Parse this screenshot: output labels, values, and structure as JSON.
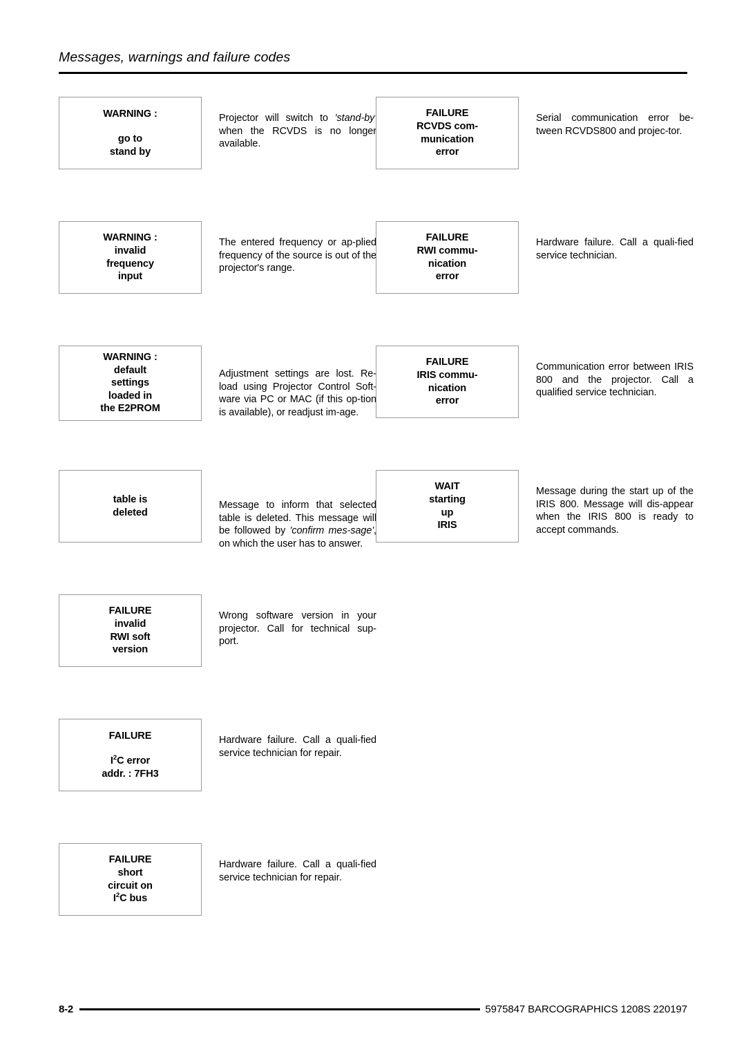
{
  "header": {
    "title": "Messages, warnings and failure codes"
  },
  "footer": {
    "page_number": "8-2",
    "reference": "5975847 BARCOGRAPHICS 1208S 220197"
  },
  "columns": {
    "left": [
      {
        "box_lines": [
          "WARNING :",
          "go to",
          "stand by"
        ],
        "gap_after_first": true,
        "description_html": "Projector will switch to <i>'stand-by'</i> when the RCVDS  is no longer available.",
        "description_text": "Projector will switch to 'stand-by' when the RCVDS is no longer available."
      },
      {
        "box_lines": [
          "WARNING :",
          "invalid",
          "frequency",
          "input"
        ],
        "gap_after_first": false,
        "description_html": "The entered frequency or ap-plied frequency of the source is out of the projector's range.",
        "description_text": "The entered frequency or applied frequency of the source is out of the projector's range."
      },
      {
        "box_lines": [
          "WARNING :",
          "default",
          "settings",
          "loaded in",
          "the E2PROM"
        ],
        "gap_after_first": false,
        "description_html": "Adjustment settings are lost. Re-load using Projector Control Soft-ware via PC or MAC (if this op-tion is available), or readjust im-age.",
        "description_text": "Adjustment settings are lost. Reload using Projector Control Software via PC or MAC (if this option is available), or readjust image."
      },
      {
        "box_lines": [
          "table is",
          "deleted"
        ],
        "gap_after_first": false,
        "description_html": "Message to inform that selected table is deleted.  This message will be followed by <i>'confirm mes-sage'</i>, on which the user has to answer.",
        "description_text": "Message to inform that selected table is deleted. This message will be followed by 'confirm message', on which the user has to answer."
      },
      {
        "box_lines": [
          "FAILURE",
          "invalid",
          "RWI soft",
          "version"
        ],
        "gap_after_first": false,
        "description_html": "Wrong software version in your projector.  Call for technical sup-port.",
        "description_text": "Wrong software version in your projector. Call for technical support."
      },
      {
        "box_lines": [
          "FAILURE",
          "I2C error",
          "addr. : 7FH3"
        ],
        "gap_after_first": true,
        "description_html": "Hardware failure.  Call a quali-fied service technician for repair.",
        "description_text": "Hardware failure. Call a qualified service technician for repair."
      },
      {
        "box_lines": [
          "FAILURE",
          "short",
          "circuit on",
          "I2C bus"
        ],
        "gap_after_first": false,
        "description_html": "Hardware failure.  Call a quali-fied service technician for repair.",
        "description_text": "Hardware failure. Call a qualified service technician for repair."
      }
    ],
    "right": [
      {
        "box_lines": [
          "FAILURE",
          "RCVDS com-",
          "munication",
          "error"
        ],
        "gap_after_first": false,
        "description_html": "Serial communication error be-tween RCVDS800 and projec-tor.",
        "description_text": "Serial communication error between RCVDS800 and projector."
      },
      {
        "box_lines": [
          "FAILURE",
          "RWI commu-",
          "nication",
          "error"
        ],
        "gap_after_first": false,
        "description_html": "Hardware failure.  Call a quali-fied service technician.",
        "description_text": "Hardware failure. Call a qualified service technician."
      },
      {
        "box_lines": [
          "FAILURE",
          "IRIS commu-",
          "nication",
          "error"
        ],
        "gap_after_first": false,
        "description_html": "Communication error between IRIS 800 and the projector. Call a qualified service technician.",
        "description_text": "Communication error between IRIS 800 and the projector. Call a qualified service technician."
      },
      {
        "box_lines": [
          "WAIT",
          "starting",
          "up",
          "IRIS"
        ],
        "gap_after_first": false,
        "description_html": "Message during the start up of the IRIS 800.  Message will dis-appear when the IRIS 800 is ready to accept commands.",
        "description_text": "Message during the start up of the IRIS 800. Message will disappear when the IRIS 800 is ready to accept commands."
      }
    ]
  }
}
